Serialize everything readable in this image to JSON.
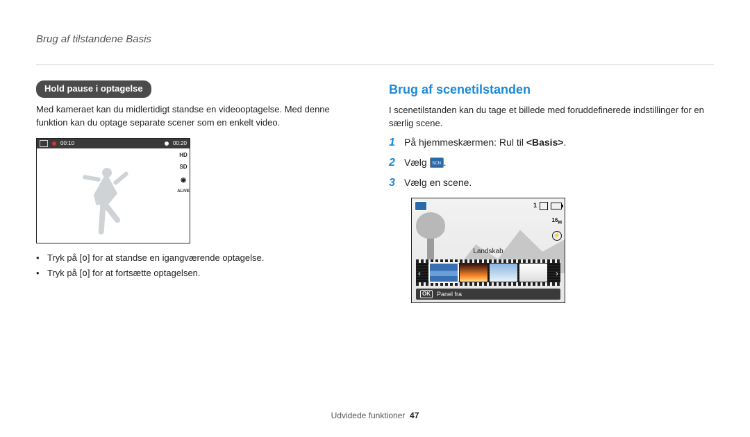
{
  "running_head": "Brug af tilstandene Basis",
  "left": {
    "pill": "Hold pause i optagelse",
    "intro": "Med kameraet kan du midlertidigt standse en videooptagelse. Med denne funktion kan du optage separate scener som en enkelt video.",
    "topbar": {
      "time_elapsed": "00:10",
      "time_total": "00:20"
    },
    "sidebar": {
      "hd": "HD",
      "sd": "SD",
      "alive": "ALIVE"
    },
    "bullets": [
      {
        "pre": "Tryk på [",
        "mid": "o",
        "post": "] for at standse en igangværende optagelse."
      },
      {
        "pre": "Tryk på [",
        "mid": "o",
        "post": "] for at fortsætte optagelsen."
      }
    ]
  },
  "right": {
    "title": "Brug af scenetilstanden",
    "intro": "I scenetilstanden kan du tage et billede med foruddefinerede indstillinger for en særlig scene.",
    "steps": {
      "s1_pre": "På hjemmeskærmen: Rul til ",
      "s1_bold": "<Basis>",
      "s1_post": ".",
      "s2": "Vælg ",
      "s2_post": ".",
      "s3": "Vælg en scene."
    },
    "preview": {
      "counter": "1",
      "mp": "16",
      "mp_suffix": "M",
      "scene_label": "Landskab",
      "panel_ok": "OK",
      "panel_text": "Panel fra"
    }
  },
  "footer": {
    "section": "Udvidede funktioner",
    "page": "47"
  }
}
